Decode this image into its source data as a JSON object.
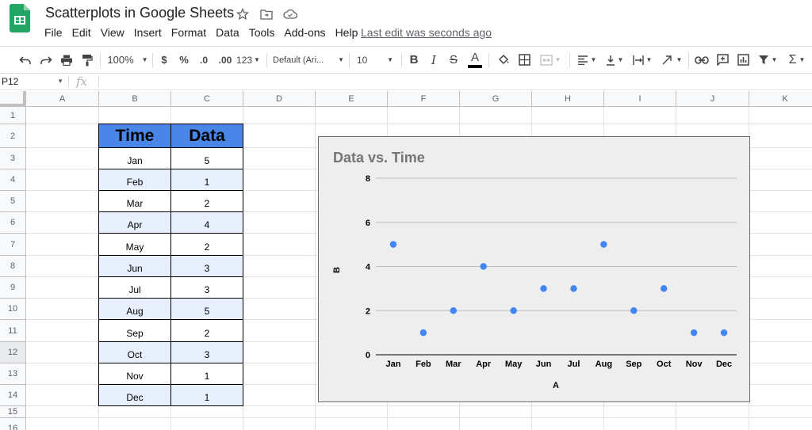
{
  "app": {
    "doc_title": "Scatterplots in Google Sheets",
    "last_edit": "Last edit was seconds ago",
    "menu": [
      "File",
      "Edit",
      "View",
      "Insert",
      "Format",
      "Data",
      "Tools",
      "Add-ons",
      "Help"
    ]
  },
  "toolbar": {
    "zoom": "100%",
    "currency": "$",
    "percent": "%",
    "decrease_decimal": ".0",
    "increase_decimal": ".00",
    "more_formats": "123",
    "font": "Default (Ari...",
    "font_size": "10",
    "text_color_accent": "#000000"
  },
  "formula_bar": {
    "name_box": "P12",
    "fx_label": "fx",
    "value": ""
  },
  "sheet": {
    "columns": [
      "A",
      "B",
      "C",
      "D",
      "E",
      "F",
      "G",
      "H",
      "I",
      "J",
      "K"
    ],
    "rows": [
      "1",
      "2",
      "3",
      "4",
      "5",
      "6",
      "7",
      "8",
      "9",
      "10",
      "11",
      "12",
      "13",
      "14",
      "15",
      "16"
    ],
    "selected_row": "12"
  },
  "table": {
    "header": [
      "Time",
      "Data"
    ],
    "rows": [
      [
        "Jan",
        "5"
      ],
      [
        "Feb",
        "1"
      ],
      [
        "Mar",
        "2"
      ],
      [
        "Apr",
        "4"
      ],
      [
        "May",
        "2"
      ],
      [
        "Jun",
        "3"
      ],
      [
        "Jul",
        "3"
      ],
      [
        "Aug",
        "5"
      ],
      [
        "Sep",
        "2"
      ],
      [
        "Oct",
        "3"
      ],
      [
        "Nov",
        "1"
      ],
      [
        "Dec",
        "1"
      ]
    ],
    "header_color": "#4a86e8",
    "band_color": "#e8f0fe"
  },
  "chart_data": {
    "type": "scatter",
    "title": "Data vs. Time",
    "xlabel": "A",
    "ylabel": "B",
    "categories": [
      "Jan",
      "Feb",
      "Mar",
      "Apr",
      "May",
      "Jun",
      "Jul",
      "Aug",
      "Sep",
      "Oct",
      "Nov",
      "Dec"
    ],
    "values": [
      5,
      1,
      2,
      4,
      2,
      3,
      3,
      5,
      2,
      3,
      1,
      1
    ],
    "ylim": [
      0,
      8
    ],
    "yticks": [
      0,
      2,
      4,
      6,
      8
    ],
    "grid": true,
    "legend": "none",
    "point_color": "#4285f4",
    "background": "#eeeeee"
  }
}
